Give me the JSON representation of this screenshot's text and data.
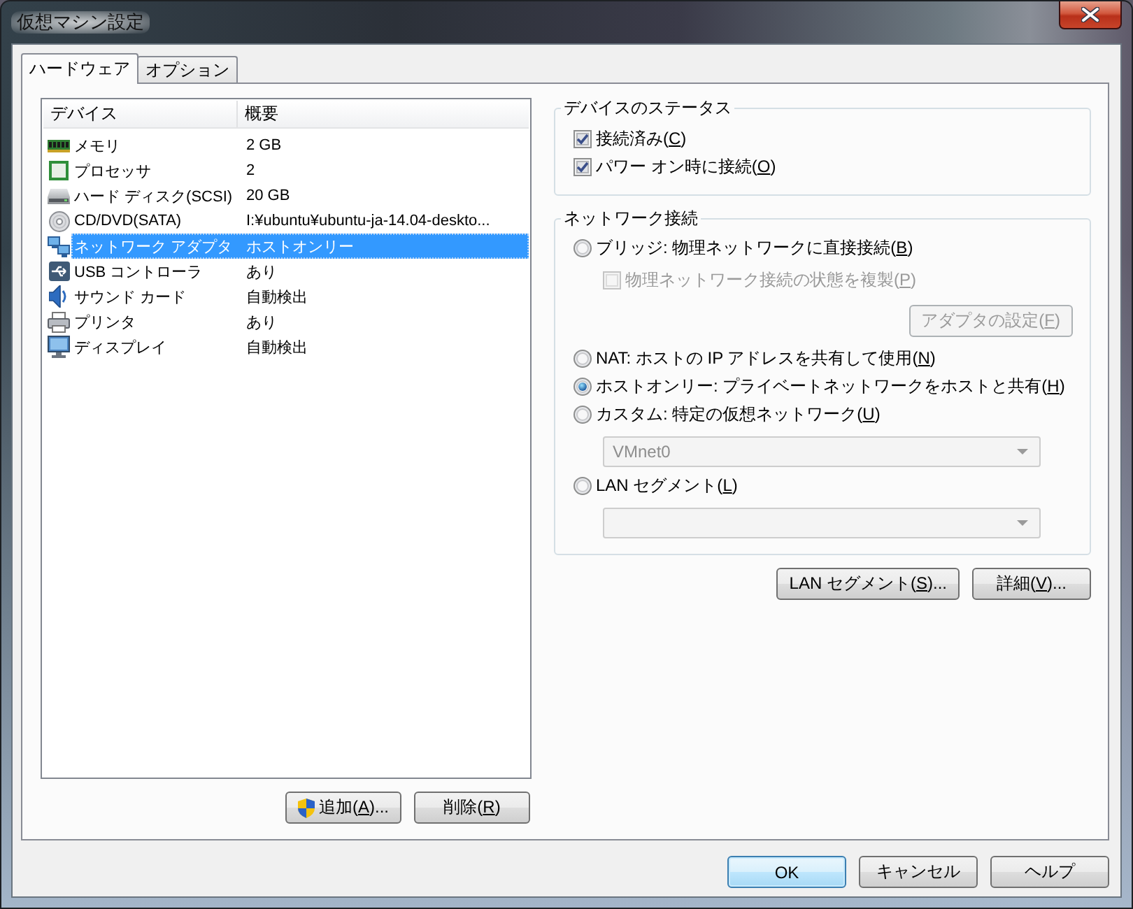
{
  "window": {
    "title": "仮想マシン設定"
  },
  "tabs": [
    {
      "label": "ハードウェア",
      "selected": true
    },
    {
      "label": "オプション",
      "selected": false
    }
  ],
  "device_list": {
    "columns": [
      "デバイス",
      "概要"
    ],
    "rows": [
      {
        "kind": "memory",
        "device": "メモリ",
        "summary": "2 GB",
        "selected": false
      },
      {
        "kind": "processor",
        "device": "プロセッサ",
        "summary": "2",
        "selected": false
      },
      {
        "kind": "hard_disk",
        "device": "ハード ディスク(SCSI)",
        "summary": "20 GB",
        "selected": false
      },
      {
        "kind": "cd_dvd",
        "device": "CD/DVD(SATA)",
        "summary": "I:¥ubuntu¥ubuntu-ja-14.04-deskto...",
        "selected": false
      },
      {
        "kind": "network",
        "device": "ネットワーク アダプタ",
        "summary": "ホストオンリー",
        "selected": true
      },
      {
        "kind": "usb",
        "device": "USB コントローラ",
        "summary": "あり",
        "selected": false
      },
      {
        "kind": "sound",
        "device": "サウンド カード",
        "summary": "自動検出",
        "selected": false
      },
      {
        "kind": "printer",
        "device": "プリンタ",
        "summary": "あり",
        "selected": false
      },
      {
        "kind": "display",
        "device": "ディスプレイ",
        "summary": "自動検出",
        "selected": false
      }
    ]
  },
  "device_buttons": [
    {
      "text": "追加(",
      "key": "A",
      "tail": ")...",
      "elevated": true
    },
    {
      "text": "削除(",
      "key": "R",
      "tail": ")",
      "elevated": false
    }
  ],
  "device_status": {
    "title": "デバイスのステータス",
    "options": [
      {
        "text": "接続済み(",
        "key": "C",
        "tail": ")",
        "checked": true
      },
      {
        "text": "パワー オン時に接続(",
        "key": "O",
        "tail": ")",
        "checked": true
      }
    ]
  },
  "network_connection": {
    "title": "ネットワーク接続",
    "options": [
      {
        "kind": "radio",
        "text": "ブリッジ: 物理ネットワークに直接接続(",
        "key": "B",
        "tail": ")",
        "selected": false,
        "disabled": false
      },
      {
        "kind": "checkbox",
        "text": "物理ネットワーク接続の状態を複製(",
        "key": "P",
        "tail": ")",
        "checked": false,
        "disabled": true
      },
      {
        "kind": "button",
        "text": "アダプタの設定(",
        "key": "F",
        "tail": ")",
        "disabled": true
      },
      {
        "kind": "radio",
        "text": "NAT: ホストの IP アドレスを共有して使用(",
        "key": "N",
        "tail": ")",
        "selected": false,
        "disabled": false
      },
      {
        "kind": "radio",
        "text": "ホストオンリー: プライベートネットワークをホストと共有(",
        "key": "H",
        "tail": ")",
        "selected": true,
        "disabled": false
      },
      {
        "kind": "radio",
        "text": "カスタム: 特定の仮想ネットワーク(",
        "key": "U",
        "tail": ")",
        "selected": false,
        "disabled": false
      },
      {
        "kind": "dropdown",
        "value": "VMnet0",
        "disabled": true
      },
      {
        "kind": "radio",
        "text": "LAN セグメント(",
        "key": "L",
        "tail": ")",
        "selected": false,
        "disabled": false
      },
      {
        "kind": "dropdown",
        "disabled": true
      }
    ]
  },
  "network_buttons": [
    {
      "text": "LAN セグメント(",
      "key": "S",
      "tail": ")..."
    },
    {
      "text": "詳細(",
      "key": "V",
      "tail": ")..."
    }
  ],
  "dialog_buttons": [
    {
      "text": "OK",
      "default": true
    },
    {
      "text": "キャンセル",
      "default": false
    },
    {
      "text": "ヘルプ",
      "default": false
    }
  ]
}
